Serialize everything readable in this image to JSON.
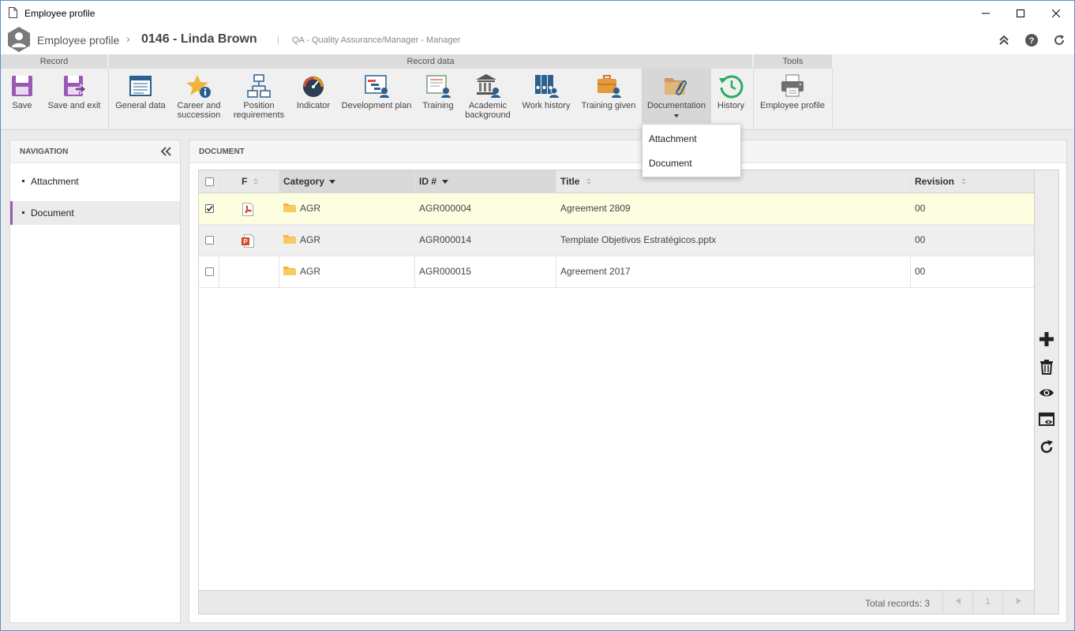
{
  "window": {
    "title": "Employee profile"
  },
  "header": {
    "app_name": "Employee profile",
    "breadcrumb_sep": "›",
    "record_title": "0146 - Linda Brown",
    "pipe": "|",
    "subtitle": "QA - Quality Assurance/Manager - Manager"
  },
  "ribbon": {
    "groups": {
      "record": "Record",
      "record_data": "Record data",
      "tools": "Tools"
    },
    "buttons": {
      "save": "Save",
      "save_exit": "Save and exit",
      "general_data": "General data",
      "career_1": "Career and",
      "career_2": "succession",
      "position_1": "Position",
      "position_2": "requirements",
      "indicator": "Indicator",
      "development_plan": "Development plan",
      "training": "Training",
      "academic_1": "Academic",
      "academic_2": "background",
      "work_history": "Work history",
      "training_given": "Training given",
      "documentation": "Documentation",
      "history": "History",
      "employee_profile": "Employee profile"
    }
  },
  "dropdown": {
    "items": [
      "Attachment",
      "Document"
    ]
  },
  "navigation": {
    "title": "NAVIGATION",
    "items": [
      {
        "label": "Attachment",
        "selected": false
      },
      {
        "label": "Document",
        "selected": true
      }
    ]
  },
  "main": {
    "title": "DOCUMENT",
    "columns": {
      "f": "F",
      "category": "Category",
      "id": "ID #",
      "title": "Title",
      "revision": "Revision"
    },
    "rows": [
      {
        "checked": true,
        "file_icon": "pdf-icon",
        "category": "AGR",
        "id": "AGR000004",
        "title": "Agreement 2809",
        "revision": "00"
      },
      {
        "checked": false,
        "file_icon": "pptx-icon",
        "category": "AGR",
        "id": "AGR000014",
        "title": "Template Objetivos Estratégicos.pptx",
        "revision": "00"
      },
      {
        "checked": false,
        "file_icon": "",
        "category": "AGR",
        "id": "AGR000015",
        "title": "Agreement 2017",
        "revision": "00"
      }
    ],
    "footer": {
      "total": "Total records: 3",
      "page": "1"
    },
    "side_actions": [
      "add-icon",
      "trash-icon",
      "eye-icon",
      "preview-window-icon",
      "refresh-icon"
    ]
  },
  "colors": {
    "accent": "#9b59b6",
    "selected_row": "#fdfde0",
    "window_border": "#5b8fcf"
  }
}
